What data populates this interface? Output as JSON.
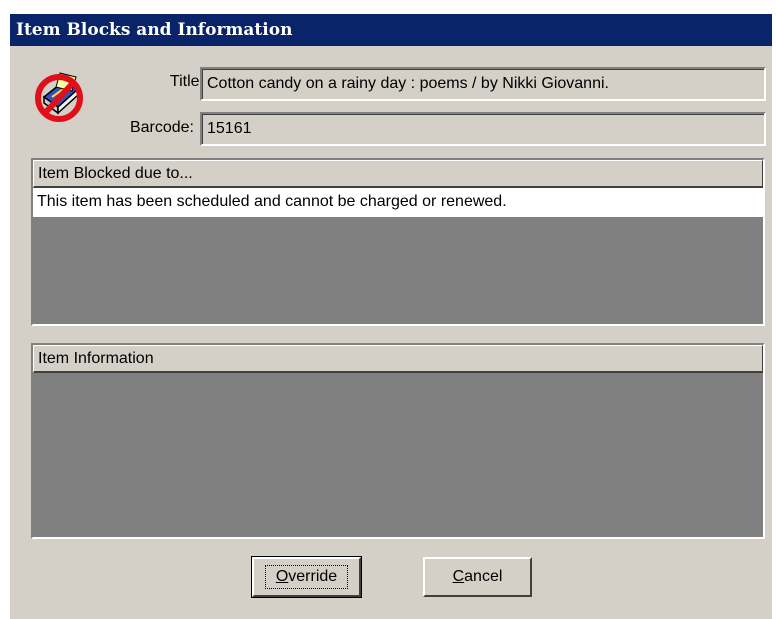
{
  "window": {
    "title": "Item Blocks and Information"
  },
  "icons": {
    "item_blocked": "blocked-book-icon"
  },
  "fields": {
    "title_label": "Title:",
    "title_value": "Cotton candy on a rainy day : poems / by Nikki Giovanni.",
    "barcode_label": "Barcode:",
    "barcode_value": "15161"
  },
  "blocks_panel": {
    "header": "Item Blocked due to...",
    "rows": [
      "This item has been scheduled and cannot be charged or renewed."
    ]
  },
  "info_panel": {
    "header": "Item Information",
    "rows": []
  },
  "buttons": {
    "override_mnemonic": "O",
    "override_rest": "verride",
    "cancel_mnemonic": "C",
    "cancel_rest": "ancel"
  },
  "colors": {
    "title_bar": "#0a246a",
    "dialog_face": "#d4d0c8",
    "empty_list": "#808080",
    "block_icon_red": "#e0101a"
  }
}
